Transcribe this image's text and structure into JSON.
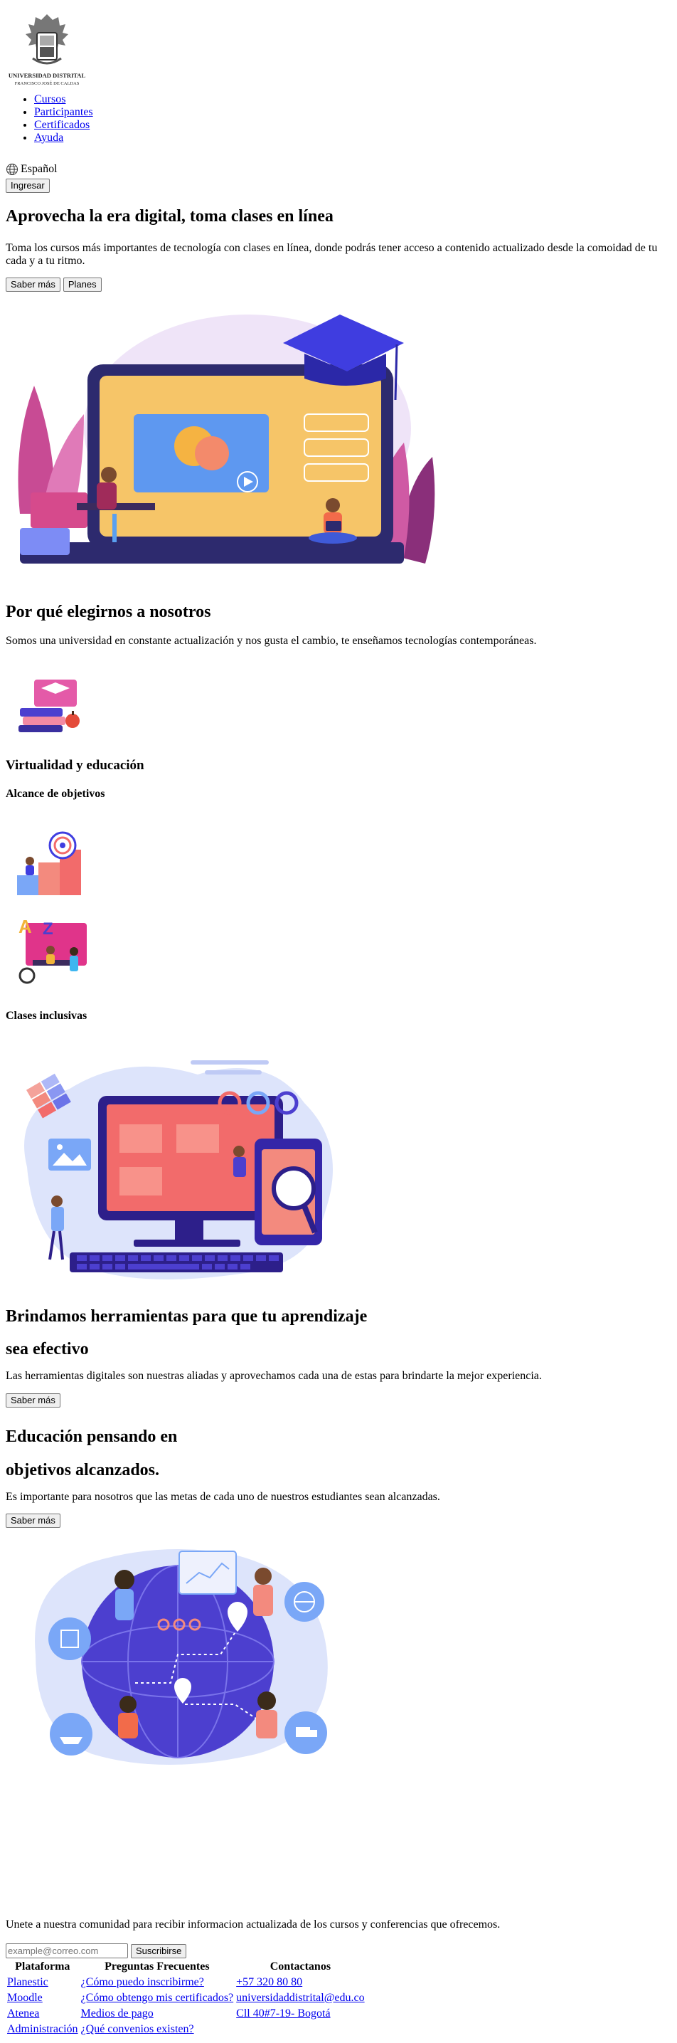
{
  "brand": {
    "logo_line1": "UNIVERSIDAD DISTRITAL",
    "logo_line2": "FRANCISCO JOSÉ DE CALDAS"
  },
  "nav": {
    "items": [
      {
        "label": "Cursos"
      },
      {
        "label": "Participantes"
      },
      {
        "label": "Certificados"
      },
      {
        "label": "Ayuda"
      }
    ],
    "language": "Español",
    "login_label": "Ingresar"
  },
  "hero": {
    "title": "Aprovecha la era digital, toma clases en línea",
    "text": "Toma los cursos más importantes de tecnología con clases en línea, donde podrás tener acceso a contenido actualizado desde la comoidad de tu cada y a tu ritmo.",
    "more_label": "Saber más",
    "plans_label": "Planes"
  },
  "why": {
    "title": "Por qué elegirnos a nosotros",
    "text": "Somos una universidad en constante actualización y nos gusta el cambio, te enseñamos tecnologías contemporáneas.",
    "feature1": "Virtualidad y educación",
    "feature2": "Alcance de objetivos",
    "feature3": "Clases inclusivas"
  },
  "tools": {
    "title_line1": "Brindamos herramientas para que tu aprendizaje",
    "title_line2": "sea efectivo",
    "text": "Las herramientas digitales son nuestras aliadas y aprovechamos cada una de estas para brindarte la mejor experiencia.",
    "button": "Saber más"
  },
  "goals": {
    "title_line1": "Educación pensando en",
    "title_line2": "objetivos alcanzados.",
    "text": "Es importante para nosotros que las metas de cada uno de nuestros estudiantes sean alcanzadas.",
    "button": "Saber más"
  },
  "newsletter": {
    "text": "Unete a nuestra comunidad para recibir informacion actualizada de los cursos y conferencias que ofrecemos.",
    "placeholder": "example@correo.com",
    "button": "Suscribirse"
  },
  "footer": {
    "headers": [
      "Plataforma",
      "Preguntas Frecuentes",
      "Contactanos"
    ],
    "col1": [
      "Planestic",
      "Moodle",
      "Atenea",
      "Administración"
    ],
    "col2": [
      "¿Cómo puedo inscribirme?",
      "¿Cómo obtengo mis certificados?",
      "Medios de pago",
      "¿Qué convenios existen?"
    ],
    "col3": [
      "+57 320 80 80",
      "universidaddistrital@edu.co",
      "Cll 40#7-19- Bogotá"
    ]
  },
  "colors": {
    "link": "#0000ee",
    "accent_purple": "#5b3fe0",
    "accent_orange": "#f5b342",
    "accent_coral": "#f36c63",
    "accent_pink": "#d53d8f"
  }
}
